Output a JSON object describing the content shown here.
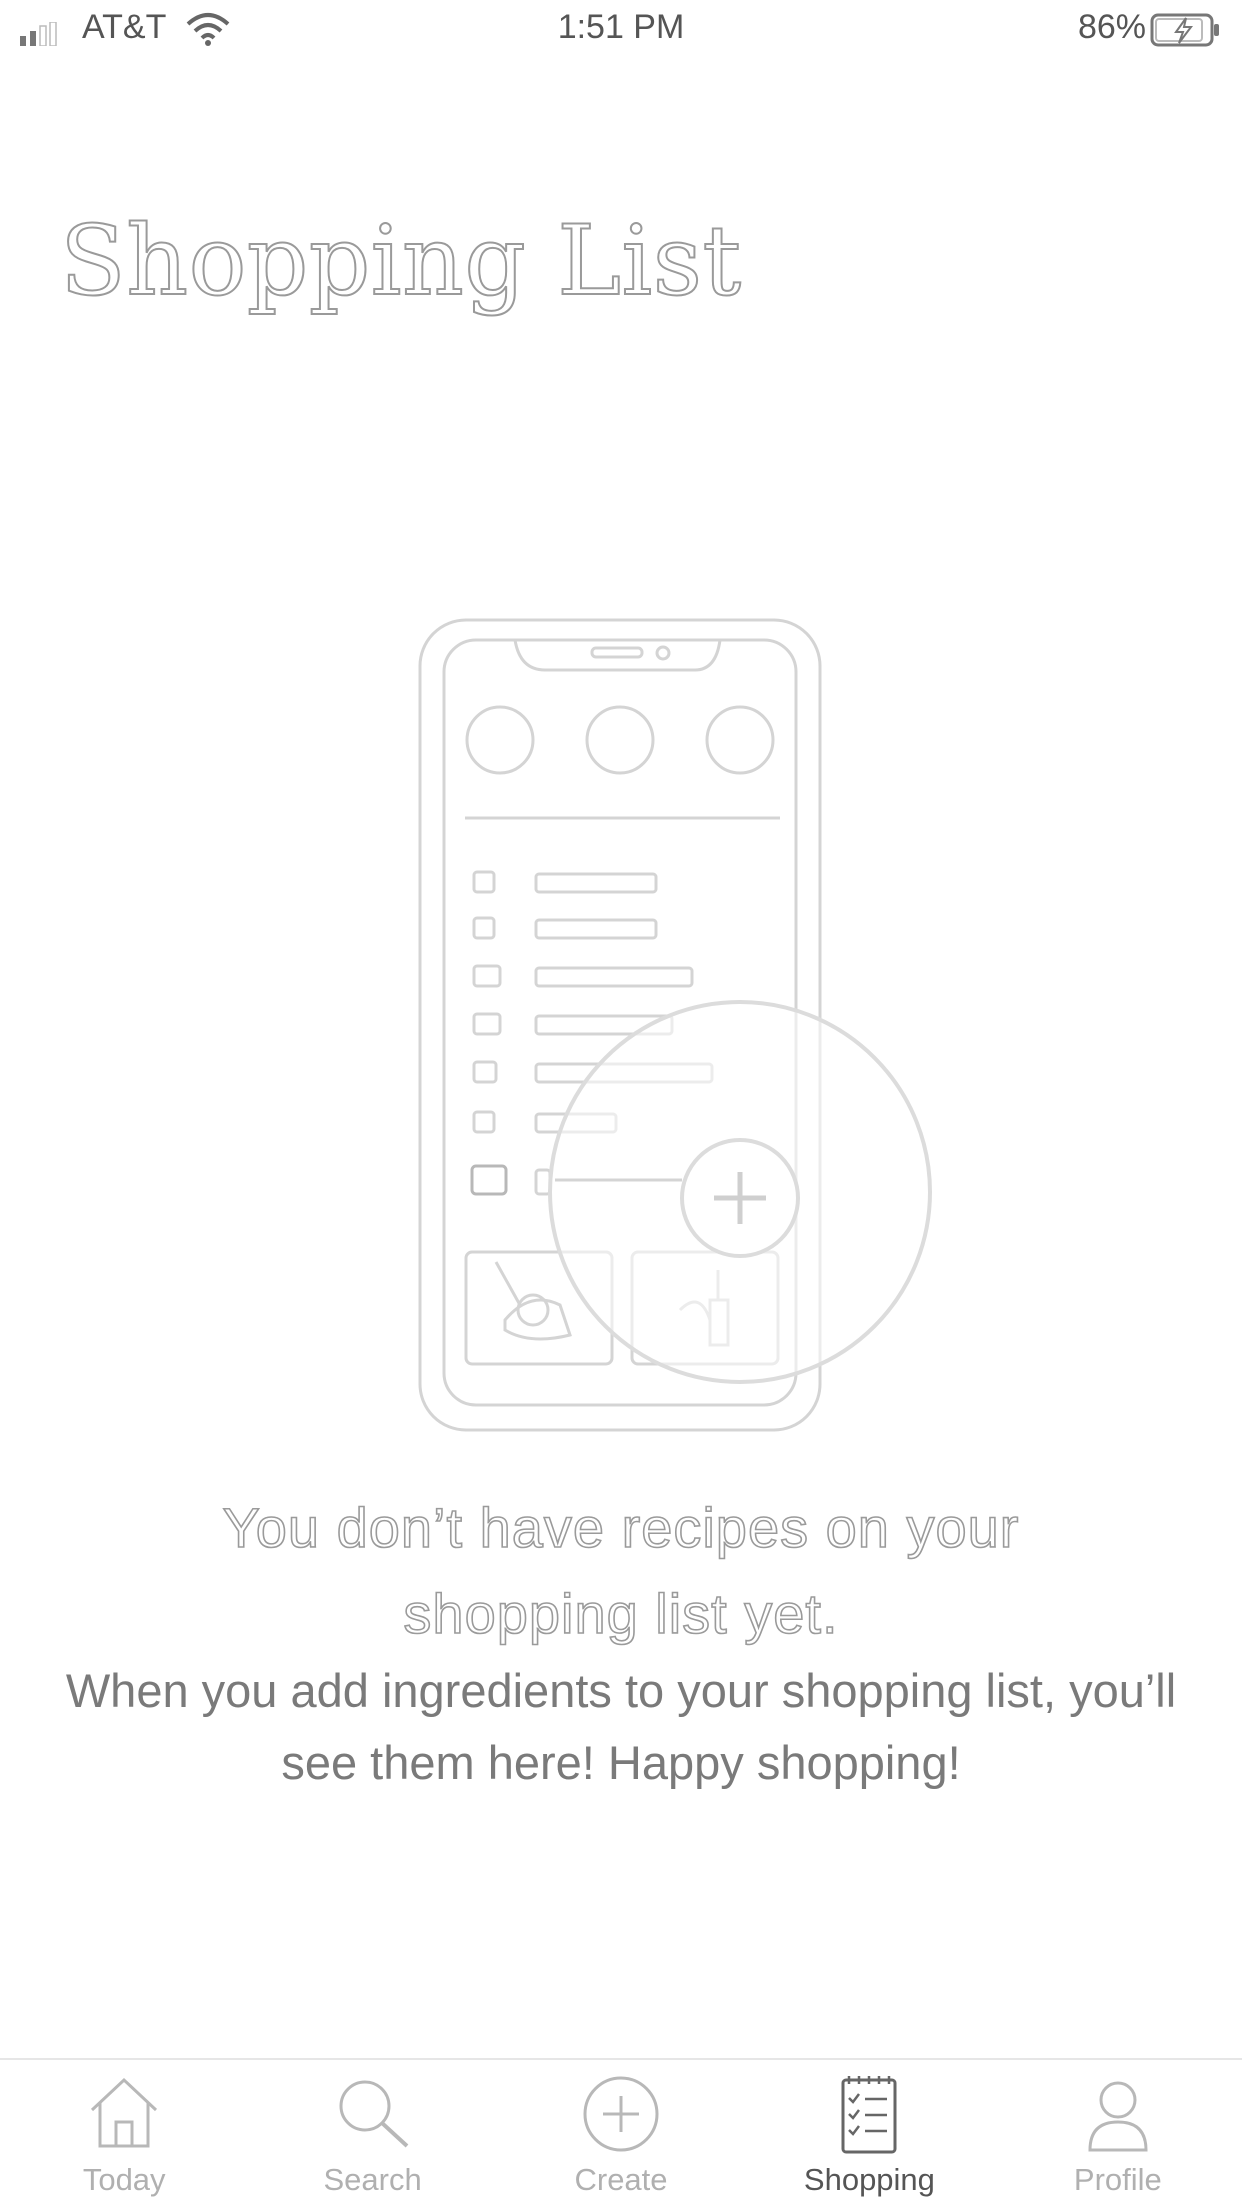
{
  "status_bar": {
    "carrier": "AT&T",
    "time": "1:51 PM",
    "battery_percent": "86%"
  },
  "page": {
    "title": "Shopping List"
  },
  "empty_state": {
    "heading": "You don’t have recipes on your shopping list yet.",
    "body": "When you add ingredients to your shopping list, you’ll see them here! Happy shopping!"
  },
  "tab_bar": {
    "active_tab": "Shopping",
    "tabs": [
      {
        "label": "Today",
        "icon": "home-icon"
      },
      {
        "label": "Search",
        "icon": "search-icon"
      },
      {
        "label": "Create",
        "icon": "plus-circle-icon"
      },
      {
        "label": "Shopping",
        "icon": "shopping-list-icon"
      },
      {
        "label": "Profile",
        "icon": "person-icon"
      }
    ]
  },
  "colors": {
    "background": "#ffffff",
    "inactive_label": "#b0b0b0",
    "active_label": "#555555",
    "outline": "#9a9a9a"
  }
}
